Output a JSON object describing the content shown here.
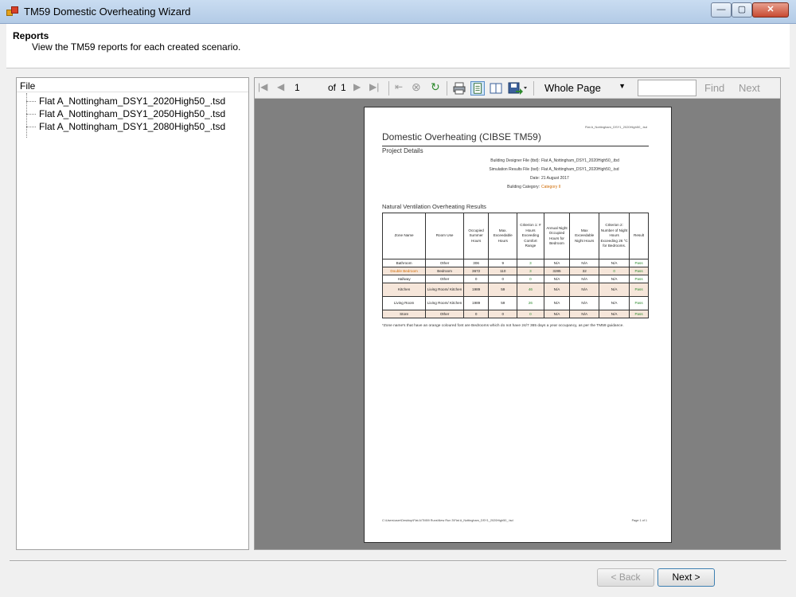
{
  "window": {
    "title": "TM59 Domestic Overheating Wizard",
    "minimize": "—",
    "maximize": "▢",
    "close": "✕"
  },
  "header": {
    "title": "Reports",
    "subtitle": "View the TM59 reports for each created scenario."
  },
  "file_list": {
    "header": "File",
    "items": [
      "Flat A_Nottingham_DSY1_2020High50_.tsd",
      "Flat A_Nottingham_DSY1_2050High50_.tsd",
      "Flat A_Nottingham_DSY1_2080High50_.tsd"
    ]
  },
  "toolbar": {
    "first": "|◀",
    "prev": "◀",
    "page": "1",
    "of_label": "of",
    "total": "1",
    "next": "▶",
    "last": "▶|",
    "back": "⇤",
    "stop": "⊗",
    "refresh": "↻",
    "zoom": "Whole Page",
    "find": "Find",
    "next_match": "Next"
  },
  "report": {
    "file_ref": "Flat A_Nottingham_DSY1_2020High50_.tsd",
    "title": "Domestic Overheating (CIBSE TM59)",
    "project_heading": "Project Details",
    "details": [
      {
        "label": "Building Designer File (tbd):",
        "value": "Flat A_Nottingham_DSY1_2020High50_.tbd"
      },
      {
        "label": "Simulation Results File (tsd):",
        "value": "Flat A_Nottingham_DSY1_2020High50_.tsd"
      },
      {
        "label": "Date:",
        "value": "21 August 2017"
      },
      {
        "label": "Building Category:",
        "value": "Category II"
      }
    ],
    "nat_heading": "Natural Ventilation Overheating Results",
    "columns": [
      "Zone Name",
      "Room Use",
      "Occupied Summer Hours",
      "Max. Exceedable Hours",
      "Criterion 1: # Hours Exceeding Comfort Range",
      "Annual Night Occupied Hours for Bedroom",
      "Max Exceedable Night Hours",
      "Criterion 2: Number of Night Hours Exceeding 26 °C for Bedrooms.",
      "Result"
    ],
    "rows": [
      {
        "zone": "Bathroom",
        "use": "Other",
        "occ": "306",
        "max": "9",
        "c1": "3",
        "annual": "N/A",
        "maxn": "N/A",
        "c2": "N/A",
        "result": "Pass"
      },
      {
        "zone": "Double Bedroom",
        "use": "Bedroom",
        "occ": "3672",
        "max": "110",
        "c1": "3",
        "annual": "3285",
        "maxn": "32",
        "c2": "0",
        "result": "Pass"
      },
      {
        "zone": "Hallway",
        "use": "Other",
        "occ": "0",
        "max": "0",
        "c1": "0",
        "annual": "N/A",
        "maxn": "N/A",
        "c2": "N/A",
        "result": "Pass"
      },
      {
        "zone": "Kitchen",
        "use": "Living Room/ Kitchen",
        "occ": "1989",
        "max": "59",
        "c1": "46",
        "annual": "N/A",
        "maxn": "N/A",
        "c2": "N/A",
        "result": "Pass"
      },
      {
        "zone": "Living Room",
        "use": "Living Room/ Kitchen",
        "occ": "1989",
        "max": "59",
        "c1": "26",
        "annual": "N/A",
        "maxn": "N/A",
        "c2": "N/A",
        "result": "Pass"
      },
      {
        "zone": "Store",
        "use": "Other",
        "occ": "0",
        "max": "0",
        "c1": "0",
        "annual": "N/A",
        "maxn": "N/A",
        "c2": "N/A",
        "result": "Pass"
      }
    ],
    "note": "*Zone name's that have an orange coloured font are Bedrooms which do not have 24/7 365 days a year occupancy, as per the TM59 guidance.",
    "footer_path": "C:\\Users\\user\\Desktop\\Flat A\\TM59 Runs\\New Run 3\\Flat A_Nottingham_DSY1_2020High50_.tsd",
    "footer_page": "Page 1 of 1"
  },
  "buttons": {
    "back": "< Back",
    "next": "Next >"
  },
  "colors": {
    "bedroom_text": "#d06a00",
    "pass_text": "#2e8a2e",
    "viewer_bg": "#808080"
  }
}
